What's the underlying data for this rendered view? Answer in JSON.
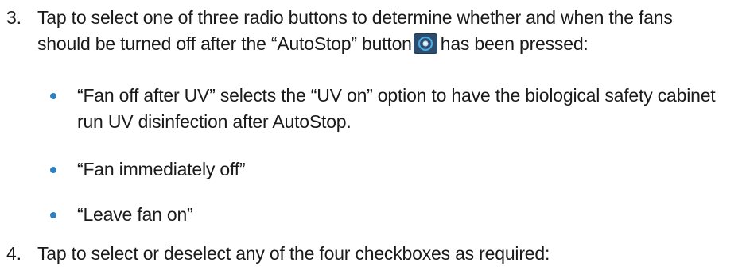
{
  "step3": {
    "number": "3.",
    "line1": "Tap to select one of three radio buttons to determine whether and when the fans",
    "line2_before_icon": "should be turned off after the “AutoStop” button",
    "icon": "autostop-button-icon",
    "line2_after_icon": "has been pressed:"
  },
  "bullets": [
    {
      "line1": "“Fan off after UV” selects the “UV on” option to have the biological safety cabinet",
      "line2": "run UV disinfection after AutoStop."
    },
    {
      "line1": "“Fan immediately off”"
    },
    {
      "line1": "“Leave fan on”"
    }
  ],
  "step4": {
    "number": "4.",
    "line1": "Tap to select or deselect any of the four checkboxes as required:"
  },
  "colors": {
    "bullet": "#2d7fc0",
    "text": "#1a1a1a",
    "icon_bg": "#1f3a55",
    "icon_ring": "#4aa8e0"
  }
}
